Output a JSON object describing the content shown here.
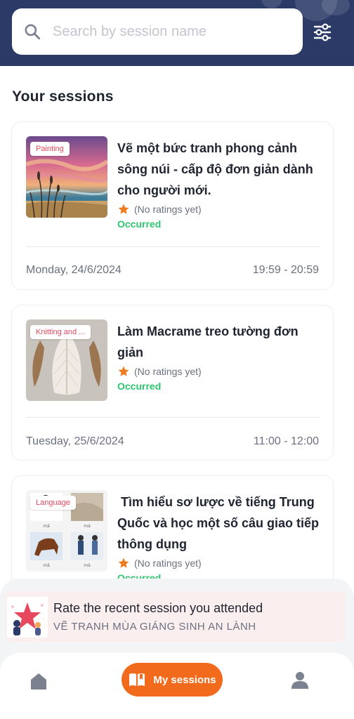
{
  "search": {
    "placeholder": "Search by session name"
  },
  "section_title": "Your sessions",
  "sessions": [
    {
      "tag": "Painting",
      "title": "Vẽ một bức tranh phong cảnh sông núi - cấp độ đơn giản dành cho người mới.",
      "rating": "(No ratings yet)",
      "status": "Occurred",
      "date": "Monday, 24/6/2024",
      "time": "19:59 - 20:59",
      "thumb_icon": "landscape-painting-image"
    },
    {
      "tag": "Knitting and ...",
      "title": "Làm Macrame treo tường đơn giản",
      "rating": "(No ratings yet)",
      "status": "Occurred",
      "date": "Tuesday, 25/6/2024",
      "time": "11:00 - 12:00",
      "thumb_icon": "macrame-leaves-image"
    },
    {
      "tag": "Language",
      "title": " Tìm hiểu sơ lược về tiếng Trung Quốc và học một số câu giao tiếp thông dụng",
      "rating": "(No ratings yet)",
      "status": "Occurred",
      "thumb_icon": "language-flashcards-image",
      "thumb_captions": [
        "mā",
        "má",
        "mǎ",
        "mà"
      ]
    }
  ],
  "rate_banner": {
    "title": "Rate the recent session you attended",
    "subtitle": "VẼ TRANH MÙA GIÁNG SINH AN LÀNH"
  },
  "nav": {
    "home_icon": "home-icon",
    "sessions_label": "My sessions",
    "profile_icon": "user-icon"
  },
  "colors": {
    "header": "#2b3a67",
    "accent": "#f26b1d",
    "tag_text": "#e8485d",
    "status_green": "#2ec56e",
    "star": "#f07a1e"
  }
}
